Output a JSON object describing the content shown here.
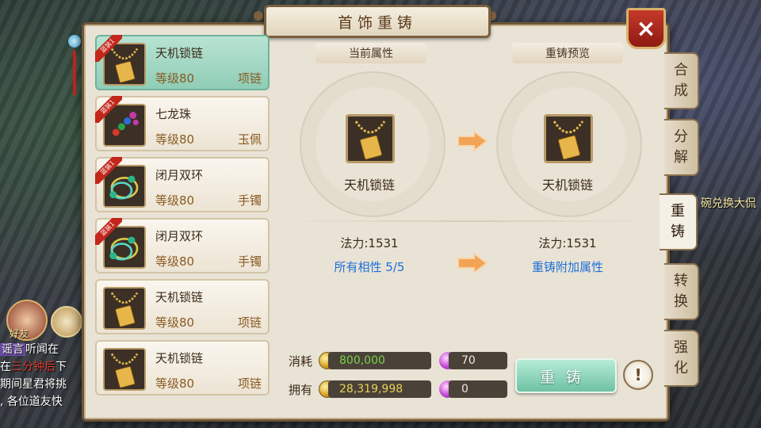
{
  "title": "首饰重铸",
  "close_label": "×",
  "items": [
    {
      "name": "天机锁链",
      "level": "等级80",
      "type": "项链",
      "badge": "蓝装1",
      "icon": "necklace-icon",
      "selected": true
    },
    {
      "name": "七龙珠",
      "level": "等级80",
      "type": "玉佩",
      "badge": "蓝装1",
      "icon": "pendant-icon",
      "selected": false
    },
    {
      "name": "闭月双环",
      "level": "等级80",
      "type": "手镯",
      "badge": "蓝装1",
      "icon": "bracelet-icon",
      "selected": false
    },
    {
      "name": "闭月双环",
      "level": "等级80",
      "type": "手镯",
      "badge": "蓝装1",
      "icon": "bracelet-icon",
      "selected": false
    },
    {
      "name": "天机锁链",
      "level": "等级80",
      "type": "项链",
      "badge": "",
      "icon": "necklace-icon",
      "selected": false
    },
    {
      "name": "天机锁链",
      "level": "等级80",
      "type": "项链",
      "badge": "",
      "icon": "necklace-icon",
      "selected": false
    }
  ],
  "current": {
    "header": "当前属性",
    "item_name": "天机锁链",
    "stat": "法力:1531",
    "extra": "所有相性  5/5"
  },
  "preview": {
    "header": "重铸预览",
    "item_name": "天机锁链",
    "stat": "法力:1531",
    "extra": "重铸附加属性"
  },
  "cost": {
    "consume_label": "消耗",
    "own_label": "拥有",
    "consume_gold": "800,000",
    "consume_gem": "70",
    "own_gold": "28,319,998",
    "own_gem": "0"
  },
  "recast_button": "重铸",
  "help_label": "!",
  "tabs": [
    "合\n成",
    "分\n解",
    "重\n铸",
    "转\n换",
    "强\n化"
  ],
  "chat": {
    "line1_tag": "谣言",
    "line1": "听闻在",
    "line2_pre": "在",
    "line2_red": "三分钟后",
    "line2_post": "下",
    "line3": "期间星君将挑",
    "line4": ", 各位道友快"
  },
  "friend_label": "好友",
  "side_text": "碗兑换大侃",
  "colors": {
    "gold": "#e8d25a",
    "blue": "#1f6fd6",
    "green": "#7ad04a",
    "red": "#e23b2e"
  }
}
